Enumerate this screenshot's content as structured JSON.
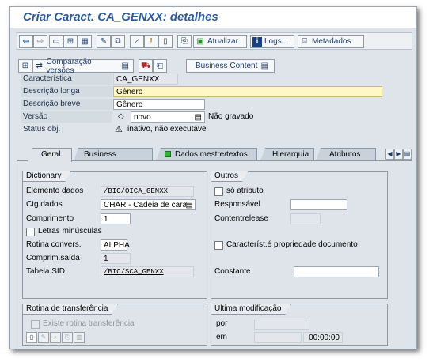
{
  "window": {
    "title": "Criar Caract. CA_GENXX: detalhes"
  },
  "toolbar": {
    "atualizar": "Atualizar",
    "logs": "Logs...",
    "metadados": "Metadados",
    "icons": [
      "arrow-left-icon",
      "arrow-right-icon",
      "screen-icon",
      "hierarchy-icon",
      "table-icon",
      "pencil-glasses-icon",
      "display-change-icon",
      "hierarchy-2-icon",
      "info-icon",
      "new-doc-icon",
      "copy-icon"
    ]
  },
  "toolbar2": {
    "comparacao": "Comparação versões",
    "business_content": "Business Content"
  },
  "header": {
    "caracteristica_label": "Característica",
    "caracteristica_value": "CA_GENXX",
    "descricao_longa_label": "Descrição longa",
    "descricao_longa_value": "Gênero",
    "descricao_breve_label": "Descrição breve",
    "descricao_breve_value": "Gênero",
    "versao_label": "Versão",
    "versao_symbol": "◇",
    "versao_value": "novo",
    "versao_status": "Não gravado",
    "status_label": "Status obj.",
    "status_value": "inativo, não executável"
  },
  "tabs": [
    "Geral",
    "Business Explorer",
    "Dados mestre/textos",
    "Hierarquia",
    "Atributos"
  ],
  "dictionary": {
    "title": "Dictionary",
    "elemento_label": "Elemento dados",
    "elemento_value": "/BIC/OICA_GENXX",
    "ctg_label": "Ctg.dados",
    "ctg_value": "CHAR - Cadeia de carac",
    "comprimento_label": "Comprimento",
    "comprimento_value": "1",
    "letras_label": "Letras minúsculas",
    "rotina_label": "Rotina convers.",
    "rotina_value": "ALPHA",
    "compr_saida_label": "Comprim.saída",
    "compr_saida_value": "1",
    "tabela_label": "Tabela SID",
    "tabela_value": "/BIC/SCA_GENXX"
  },
  "outros": {
    "title": "Outros",
    "so_atributo": "só atributo",
    "responsavel": "Responsável",
    "contentrelease": "Contentrelease",
    "propriedade": "Característ.é propriedade documento",
    "constante": "Constante"
  },
  "rotina_transf": {
    "title": "Rotina de transferência",
    "existe": "Existe rotina transferência"
  },
  "ultima_mod": {
    "title": "Última modificação",
    "por": "por",
    "em": "em",
    "time": "00:00:00"
  }
}
